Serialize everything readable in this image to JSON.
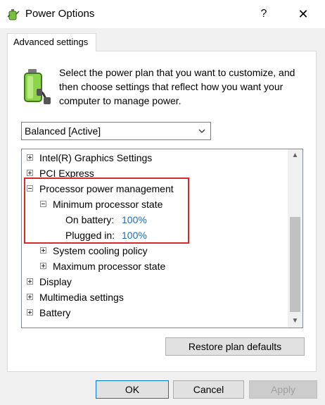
{
  "window": {
    "title": "Power Options",
    "help_label": "?",
    "close_label": "✕"
  },
  "tab": {
    "label": "Advanced settings"
  },
  "intro": {
    "text": "Select the power plan that you want to customize, and then choose settings that reflect how you want your computer to manage power."
  },
  "plan": {
    "selected": "Balanced [Active]"
  },
  "tree": {
    "items": [
      {
        "label": "Intel(R) Graphics Settings",
        "state": "collapsed",
        "level": 0
      },
      {
        "label": "PCI Express",
        "state": "collapsed",
        "level": 0
      },
      {
        "label": "Processor power management",
        "state": "expanded",
        "level": 0
      },
      {
        "label": "Minimum processor state",
        "state": "expanded",
        "level": 1
      },
      {
        "label": "On battery:",
        "value": "100%",
        "level": 2
      },
      {
        "label": "Plugged in:",
        "value": "100%",
        "level": 2
      },
      {
        "label": "System cooling policy",
        "state": "collapsed",
        "level": 1
      },
      {
        "label": "Maximum processor state",
        "state": "collapsed",
        "level": 1
      },
      {
        "label": "Display",
        "state": "collapsed",
        "level": 0
      },
      {
        "label": "Multimedia settings",
        "state": "collapsed",
        "level": 0
      },
      {
        "label": "Battery",
        "state": "collapsed",
        "level": 0
      }
    ]
  },
  "buttons": {
    "restore": "Restore plan defaults",
    "ok": "OK",
    "cancel": "Cancel",
    "apply": "Apply"
  },
  "colors": {
    "value_link": "#1a6fc4",
    "highlight_box": "#d42a2a",
    "ok_border": "#0078d7"
  }
}
